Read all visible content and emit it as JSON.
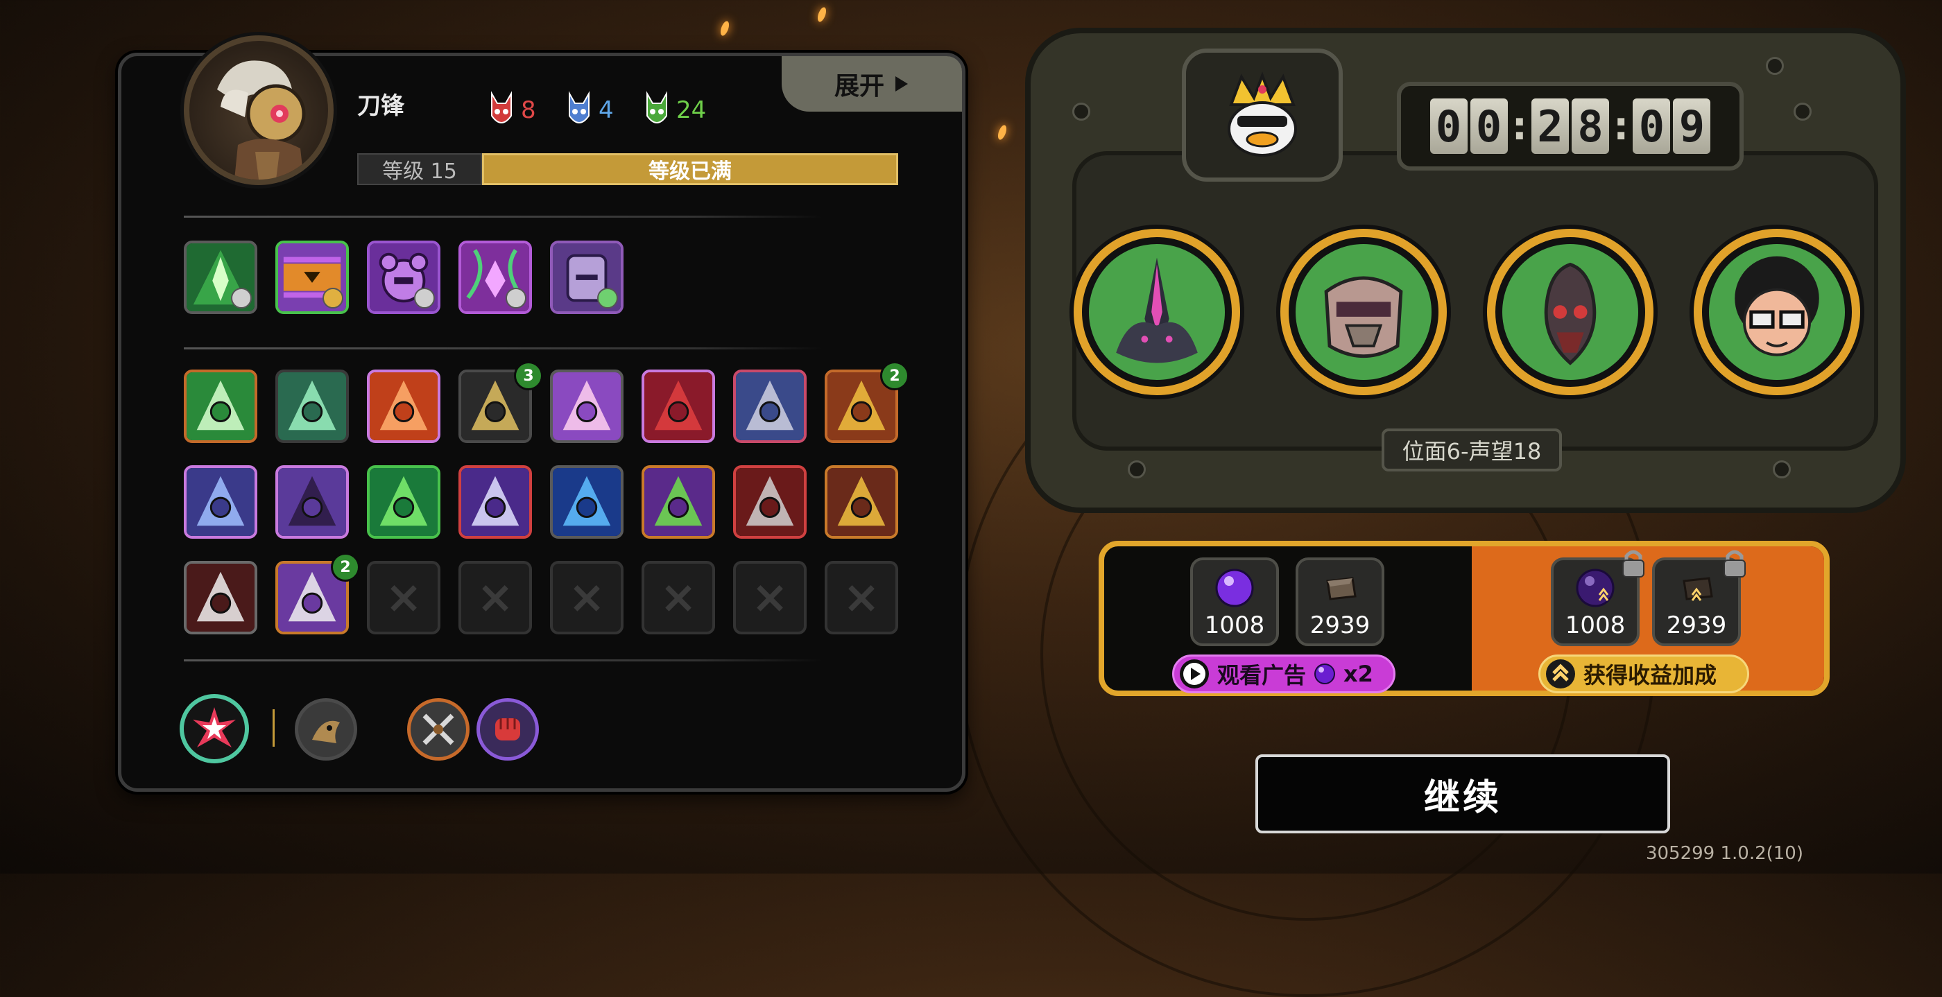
{
  "hero": {
    "name": "刀锋",
    "stats": [
      {
        "icon": "red-mask-icon",
        "value": "8",
        "color": "#e04848"
      },
      {
        "icon": "blue-mask-icon",
        "value": "4",
        "color": "#5fa6e8"
      },
      {
        "icon": "green-mask-icon",
        "value": "24",
        "color": "#6fd04a"
      }
    ],
    "level_label": "等级 15",
    "level_status": "等级已满",
    "expand_label": "展开"
  },
  "equipment": [
    {
      "icon": "green-blade-emblem-icon"
    },
    {
      "icon": "orange-chest-armor-icon"
    },
    {
      "icon": "purple-orb-mech-icon"
    },
    {
      "icon": "pink-vine-crystal-icon"
    },
    {
      "icon": "purple-plate-shield-icon"
    }
  ],
  "skills": [
    {
      "icon": "green-shield-heal-icon",
      "badge": ""
    },
    {
      "icon": "green-slash-wave-icon",
      "badge": ""
    },
    {
      "icon": "fire-claws-icon",
      "badge": ""
    },
    {
      "icon": "gold-core-frame-icon",
      "badge": "3"
    },
    {
      "icon": "pink-sword-crystal-icon",
      "badge": ""
    },
    {
      "icon": "red-figure-icon",
      "badge": ""
    },
    {
      "icon": "armored-fist-icon",
      "badge": ""
    },
    {
      "icon": "golden-blade-icon",
      "badge": "2"
    },
    {
      "icon": "lightning-capsule-icon",
      "badge": ""
    },
    {
      "icon": "purple-tower-icon",
      "badge": ""
    },
    {
      "icon": "green-diamond-rune-icon",
      "badge": ""
    },
    {
      "icon": "crossed-swords-cat-icon",
      "badge": ""
    },
    {
      "icon": "blue-lightning-dragon-icon",
      "badge": ""
    },
    {
      "icon": "green-arrow-up-icon",
      "badge": ""
    },
    {
      "icon": "red-axe-icon",
      "badge": ""
    },
    {
      "icon": "gold-helmet-icon",
      "badge": ""
    },
    {
      "icon": "red-claw-strikes-icon",
      "badge": ""
    },
    {
      "icon": "purple-staircase-icon",
      "badge": "2"
    }
  ],
  "empty_slot_count": 6,
  "bottom_icons": [
    "burst-star-icon",
    "beast-portrait-icon",
    "crossed-blades-icon",
    "red-fist-icon"
  ],
  "timer": {
    "digits": [
      "0",
      "0",
      "2",
      "8",
      "0",
      "9"
    ]
  },
  "crown_icon": "crowned-duck-icon",
  "team": [
    {
      "icon": "dark-horned-creature-icon"
    },
    {
      "icon": "masked-robot-icon"
    },
    {
      "icon": "red-eyed-beast-icon"
    },
    {
      "icon": "curly-hair-glasses-icon"
    }
  ],
  "stage_label": "位面6-声望18",
  "rewards": {
    "free": [
      {
        "icon": "purple-orb-icon",
        "value": "1008"
      },
      {
        "icon": "dark-ingot-icon",
        "value": "2939"
      }
    ],
    "boosted": [
      {
        "icon": "purple-orb-icon",
        "value": "1008"
      },
      {
        "icon": "dark-ingot-icon",
        "value": "2939"
      }
    ],
    "watch_ad_label": "观看广告",
    "watch_ad_multiplier": "x2",
    "boost_label": "获得收益加成"
  },
  "continue_label": "继续",
  "version": "305299 1.0.2(10)",
  "colors": {
    "gold": "#e2a62b",
    "orange": "#dd6a1b",
    "green": "#49a34a",
    "purple": "#c93cd6"
  }
}
